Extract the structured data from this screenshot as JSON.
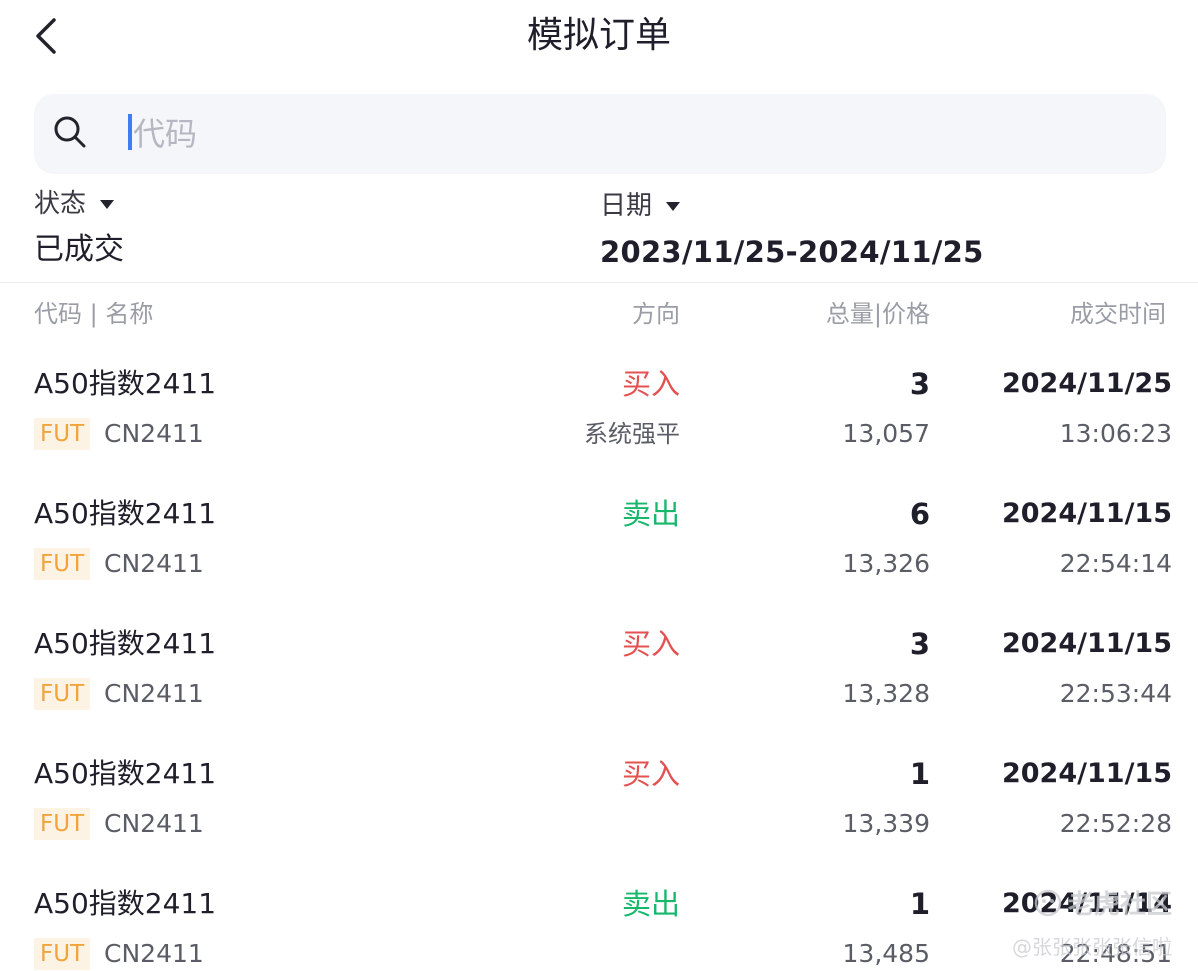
{
  "header": {
    "title": "模拟订单"
  },
  "search": {
    "placeholder": "代码"
  },
  "filters": {
    "status": {
      "label": "状态",
      "value": "已成交"
    },
    "date": {
      "label": "日期",
      "value": "2023/11/25-2024/11/25"
    }
  },
  "columns": {
    "code_name": "代码 | 名称",
    "direction": "方向",
    "qty_price": "总量|价格",
    "time": "成交时间"
  },
  "orders": [
    {
      "name": "A50指数2411",
      "badge": "FUT",
      "code": "CN2411",
      "direction": "买入",
      "side": "buy",
      "note": "系统强平",
      "qty": "3",
      "price": "13,057",
      "date": "2024/11/25",
      "time": "13:06:23"
    },
    {
      "name": "A50指数2411",
      "badge": "FUT",
      "code": "CN2411",
      "direction": "卖出",
      "side": "sell",
      "note": "",
      "qty": "6",
      "price": "13,326",
      "date": "2024/11/15",
      "time": "22:54:14"
    },
    {
      "name": "A50指数2411",
      "badge": "FUT",
      "code": "CN2411",
      "direction": "买入",
      "side": "buy",
      "note": "",
      "qty": "3",
      "price": "13,328",
      "date": "2024/11/15",
      "time": "22:53:44"
    },
    {
      "name": "A50指数2411",
      "badge": "FUT",
      "code": "CN2411",
      "direction": "买入",
      "side": "buy",
      "note": "",
      "qty": "1",
      "price": "13,339",
      "date": "2024/11/15",
      "time": "22:52:28"
    },
    {
      "name": "A50指数2411",
      "badge": "FUT",
      "code": "CN2411",
      "direction": "卖出",
      "side": "sell",
      "note": "",
      "qty": "1",
      "price": "13,485",
      "date": "2024/11/14",
      "time": "22:48:51"
    }
  ],
  "watermark": {
    "title": "老虎社区",
    "user": "@张张张张张信啦"
  },
  "colors": {
    "buy": "#e35151",
    "sell": "#17b86c",
    "badge_text": "#f0a43a",
    "caret": "#3d7cf3"
  }
}
